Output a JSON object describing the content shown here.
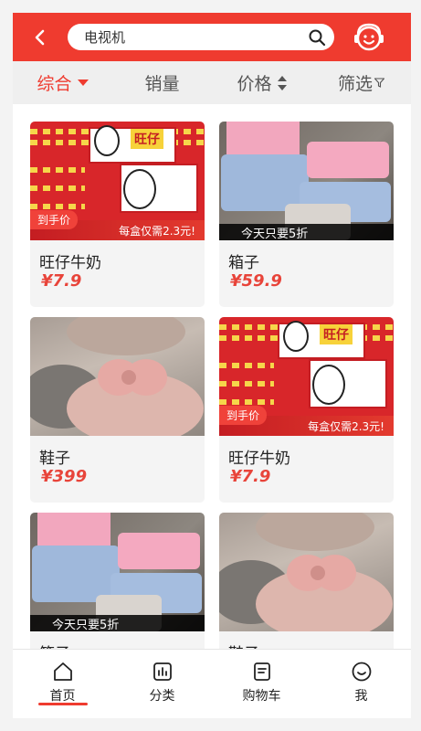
{
  "header": {
    "back_icon": "chevron-left-icon",
    "search_value": "电视机",
    "search_icon": "search-icon",
    "avatar_icon": "smiley-headset-icon"
  },
  "tabs": [
    {
      "label": "综合",
      "marker": "triangle-down",
      "active": true
    },
    {
      "label": "销量",
      "marker": "",
      "active": false
    },
    {
      "label": "价格",
      "marker": "sort-updown",
      "active": false
    },
    {
      "label": "筛选",
      "marker": "filter-icon",
      "active": false
    }
  ],
  "products": [
    {
      "name": "旺仔牛奶",
      "price": "¥7.9",
      "image": "milk"
    },
    {
      "name": "箱子",
      "price": "¥59.9",
      "image": "box"
    },
    {
      "name": "鞋子",
      "price": "¥399",
      "image": "shoe"
    },
    {
      "name": "旺仔牛奶",
      "price": "¥7.9",
      "image": "milk"
    },
    {
      "name": "箱子",
      "price": "",
      "image": "box"
    },
    {
      "name": "鞋子",
      "price": "",
      "image": "shoe"
    }
  ],
  "image_text": {
    "milk_promo_left": "到手价",
    "milk_promo_bottom": "每盒仅需2.3元!",
    "milk_logo": "旺仔",
    "box_strip": "今天只要5折"
  },
  "bottom_nav": [
    {
      "label": "首页",
      "icon": "home-icon",
      "active": true
    },
    {
      "label": "分类",
      "icon": "chart-icon",
      "active": false
    },
    {
      "label": "购物车",
      "icon": "document-icon",
      "active": false
    },
    {
      "label": "我",
      "icon": "smiley-icon",
      "active": false
    }
  ],
  "colors": {
    "accent": "#ef3b2f",
    "price": "#e8443a",
    "tab_bg": "#efefef",
    "card_bg": "#f4f4f4"
  }
}
